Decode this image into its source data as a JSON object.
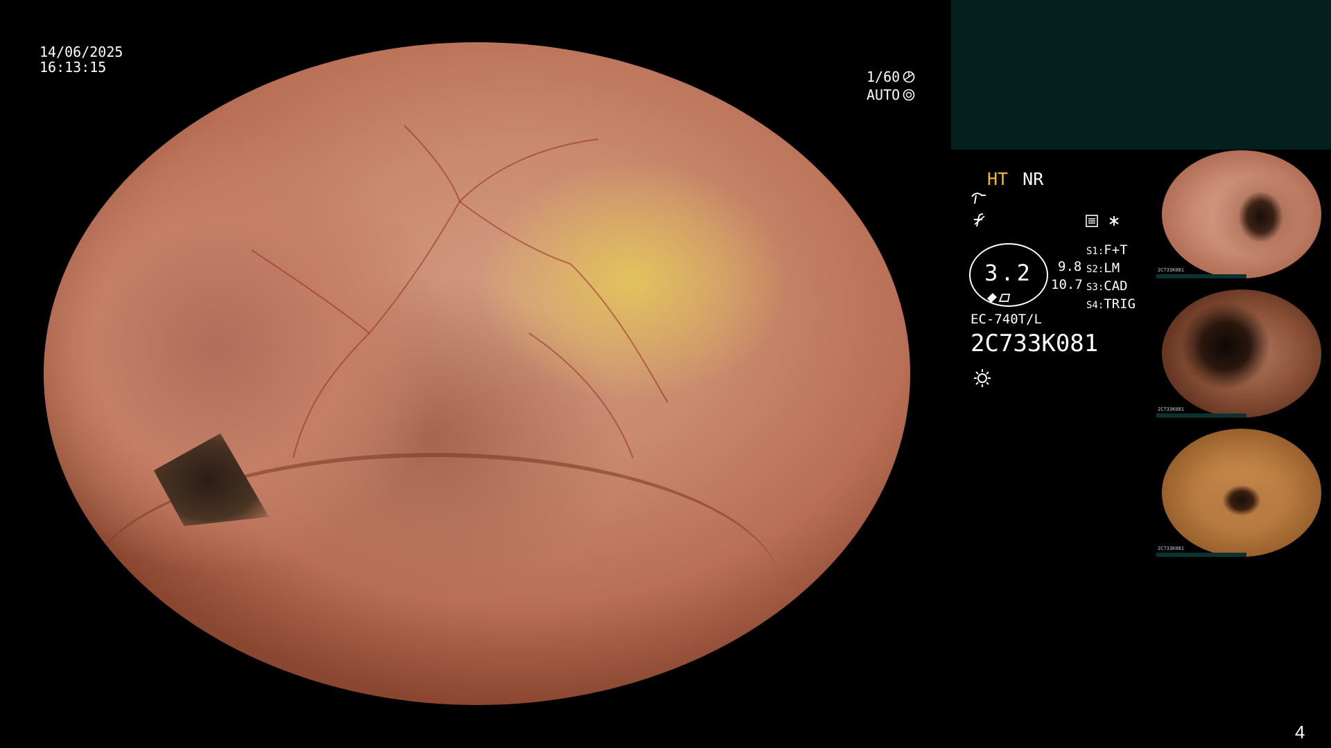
{
  "header": {
    "date": "14/06/2025",
    "time": "16:13:15"
  },
  "shutter": {
    "speed": "1/60",
    "mode": "AUTO"
  },
  "modes": {
    "ht": "HT",
    "nr": "NR"
  },
  "scope": {
    "value": "3.2",
    "right_top": "9.8",
    "right_bottom": "10.7",
    "model": "EC-740T/L",
    "serial": "2C733K081"
  },
  "switches": [
    {
      "key": "S1:",
      "value": "F+T"
    },
    {
      "key": "S2:",
      "value": "LM"
    },
    {
      "key": "S3:",
      "value": "CAD"
    },
    {
      "key": "S4:",
      "value": "TRIG"
    }
  ],
  "thumbnails": [
    {
      "mini_label": "2C733K081"
    },
    {
      "mini_label": "2C733K081"
    },
    {
      "mini_label": "2C733K081"
    }
  ],
  "page_number": "4",
  "colors": {
    "ht_accent": "#f5b82e",
    "panel": "#03201f"
  },
  "icons": [
    "curve-icon",
    "strike-f-icon",
    "memo-icon",
    "asterisk-icon",
    "shutter-icon",
    "light-icon"
  ]
}
